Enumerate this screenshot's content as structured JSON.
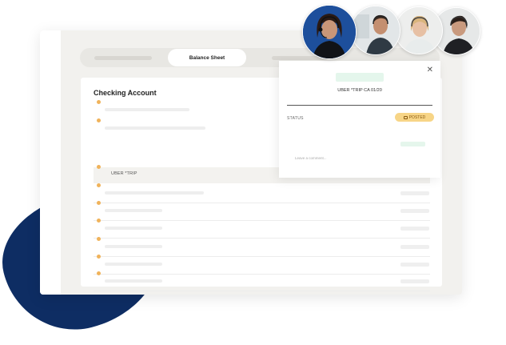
{
  "tabs": {
    "active_label": "Balance Sheet"
  },
  "panel": {
    "title": "Checking Account",
    "highlighted_row_label": "UBER *TRIP"
  },
  "detail": {
    "close_icon": "close-icon",
    "transaction_title": "UBER *TRIP CA 01/20",
    "status_label": "STATUS",
    "status_value": "POSTED",
    "comment_placeholder": "Leave a comment..."
  },
  "colors": {
    "accent_dot": "#f0b35b",
    "blob": "#0e2d63",
    "status_badge_bg": "#f7d587",
    "status_badge_text": "#8a5a10",
    "amount_highlight": "#e4f6ec"
  },
  "avatars": [
    "avatar-agent-1",
    "avatar-agent-2",
    "avatar-agent-3",
    "avatar-agent-4"
  ]
}
